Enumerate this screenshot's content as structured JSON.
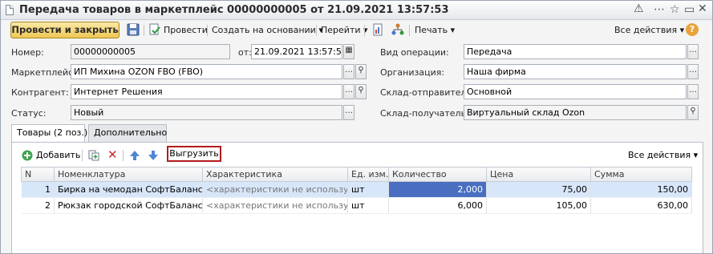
{
  "window": {
    "title": "Передача товаров в маркетплейс 00000000005 от 21.09.2021 13:57:53"
  },
  "toolbar": {
    "post_close": "Провести и закрыть",
    "post": "Провести",
    "create_based": "Создать на основании",
    "go_to": "Перейти",
    "print": "Печать",
    "all_actions": "Все действия",
    "help": "?"
  },
  "form": {
    "number_label": "Номер:",
    "number_value": "00000000005",
    "date_label": "от:",
    "date_value": "21.09.2021 13:57:53",
    "marketplace_label": "Маркетплейс:",
    "marketplace_value": "ИП Михина OZON FBO (FBO)",
    "counterparty_label": "Контрагент:",
    "counterparty_value": "Интернет Решения",
    "status_label": "Статус:",
    "status_value": "Новый",
    "operation_label": "Вид операции:",
    "operation_value": "Передача",
    "org_label": "Организация:",
    "org_value": "Наша фирма",
    "sender_label": "Склад-отправитель:",
    "sender_value": "Основной",
    "receiver_label": "Склад-получатель:",
    "receiver_value": "Виртуальный склад  Ozon"
  },
  "tabs": [
    {
      "label": "Товары (2 поз.)"
    },
    {
      "label": "Дополнительно"
    }
  ],
  "table_toolbar": {
    "add": "Добавить",
    "unload": "Выгрузить",
    "all_actions": "Все действия"
  },
  "table": {
    "columns": [
      "N",
      "Номенклатура",
      "Характеристика",
      "Ед. изм.",
      "Количество",
      "Цена",
      "Сумма"
    ],
    "rows": [
      [
        "1",
        "Бирка на чемодан СофтБаланс",
        "<характеристики не используют...",
        "шт",
        "2,000",
        "75,00",
        "150,00"
      ],
      [
        "2",
        "Рюкзак городской СофтБаланс",
        "<характеристики не используют...",
        "шт",
        "6,000",
        "105,00",
        "630,00"
      ]
    ]
  },
  "icons": {
    "save": "floppy-icon",
    "post": "post-document-icon",
    "report1": "report-icon",
    "report2": "structure-icon",
    "add": "add-circle-icon",
    "copy": "copy-icon",
    "delete": "delete-icon",
    "up": "arrow-up-icon",
    "down": "arrow-down-icon"
  },
  "colors": {
    "accent_button": "#f0c755",
    "selection": "#d8e6fa",
    "active_cell": "#4a6fc1",
    "highlight_border": "#b31b1b"
  }
}
